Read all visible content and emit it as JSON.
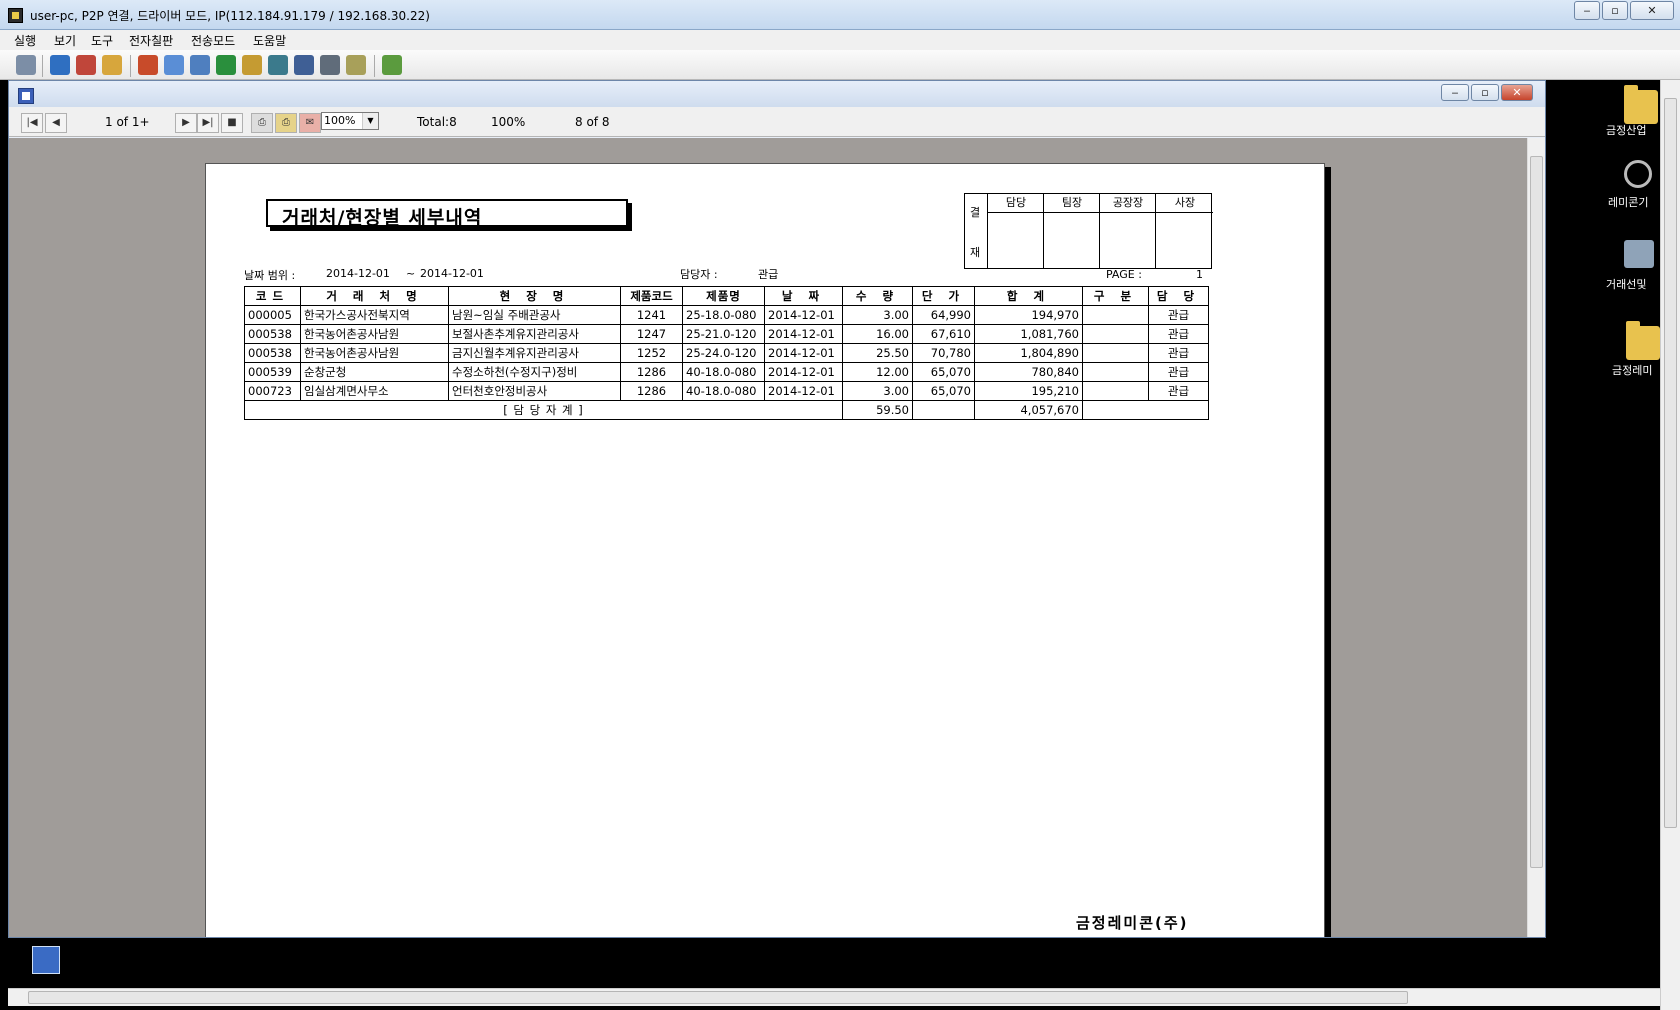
{
  "window": {
    "title": "user-pc, P2P 연결, 드라이버 모드, IP(112.184.91.179 / 192.168.30.22)",
    "minimize": "‒",
    "maximize": "▫",
    "close": "✕"
  },
  "menu": [
    "실행",
    "보기",
    "도구",
    "전자칠판",
    "전송모드",
    "도움말"
  ],
  "desktop_icons": [
    {
      "label": "금정산업",
      "icon": "folder-icon"
    },
    {
      "label": "레미콘기",
      "icon": "magnifier-icon"
    },
    {
      "label": "거래선및",
      "icon": "people-icon"
    },
    {
      "label": "금정레미",
      "icon": "folder-icon"
    }
  ],
  "viewer": {
    "page_indicator": "1 of 1+",
    "zoom": "100%",
    "total": "Total:8",
    "percent": "100%",
    "record_pos": "8 of 8"
  },
  "report": {
    "title": "거래처/현장별   세부내역",
    "approval_header": [
      "담당",
      "팀장",
      "공장장",
      "사장"
    ],
    "approval_side": [
      "결",
      "재"
    ],
    "date_range_label": "날짜 범위 :",
    "date_from": "2014-12-01",
    "date_sep": "~",
    "date_to": "2014-12-01",
    "manager_label": "담당자 :",
    "manager": "관급",
    "page_label": "PAGE :",
    "page_no": "1",
    "columns": [
      "코드",
      "거 래 처 명",
      "현 장 명",
      "제품코드",
      "제품명",
      "날 짜",
      "수 량",
      "단 가",
      "합 계",
      "구 분",
      "담 당"
    ],
    "rows": [
      [
        "000005",
        "한국가스공사전북지역",
        "남원~임실 주배관공사",
        "1241",
        "25-18.0-080",
        "2014-12-01",
        "3.00",
        "64,990",
        "194,970",
        "",
        "관급"
      ],
      [
        "000538",
        "한국농어촌공사남원",
        "보절사촌추계유지관리공사",
        "1247",
        "25-21.0-120",
        "2014-12-01",
        "16.00",
        "67,610",
        "1,081,760",
        "",
        "관급"
      ],
      [
        "000538",
        "한국농어촌공사남원",
        "금지신월추계유지관리공사",
        "1252",
        "25-24.0-120",
        "2014-12-01",
        "25.50",
        "70,780",
        "1,804,890",
        "",
        "관급"
      ],
      [
        "000539",
        "순창군청",
        "수정소하천(수정지구)정비",
        "1286",
        "40-18.0-080",
        "2014-12-01",
        "12.00",
        "65,070",
        "780,840",
        "",
        "관급"
      ],
      [
        "000723",
        "임실삼계면사무소",
        "언터천호안정비공사",
        "1286",
        "40-18.0-080",
        "2014-12-01",
        "3.00",
        "65,070",
        "195,210",
        "",
        "관급"
      ]
    ],
    "subtotal_label": "[ 담 당 자 계 ]",
    "subtotal_qty": "59.50",
    "subtotal_amount": "4,057,670",
    "company": "금정레미콘(주)"
  }
}
